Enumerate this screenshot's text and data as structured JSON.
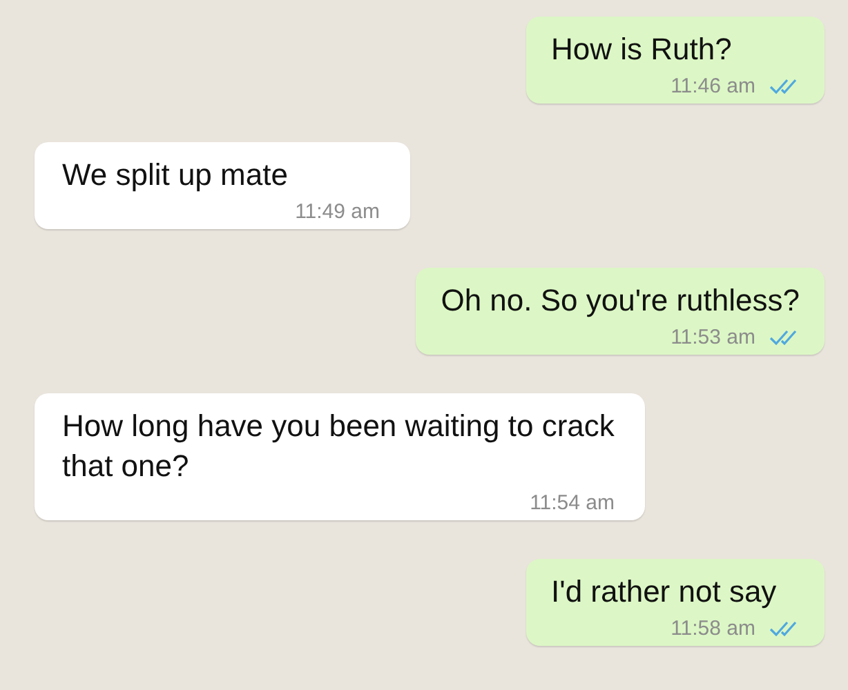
{
  "messages": [
    {
      "kind": "sent",
      "text": "How is Ruth?",
      "time": "11:46 am",
      "read": true
    },
    {
      "kind": "received",
      "text": "We split up mate",
      "time": "11:49 am"
    },
    {
      "kind": "sent",
      "text": "Oh no. So you're ruthless?",
      "time": "11:53 am",
      "read": true
    },
    {
      "kind": "received",
      "text": "How long have you been waiting to crack that one?",
      "time": "11:54 am"
    },
    {
      "kind": "sent",
      "text": "I'd rather not say",
      "time": "11:58 am",
      "read": true
    }
  ]
}
